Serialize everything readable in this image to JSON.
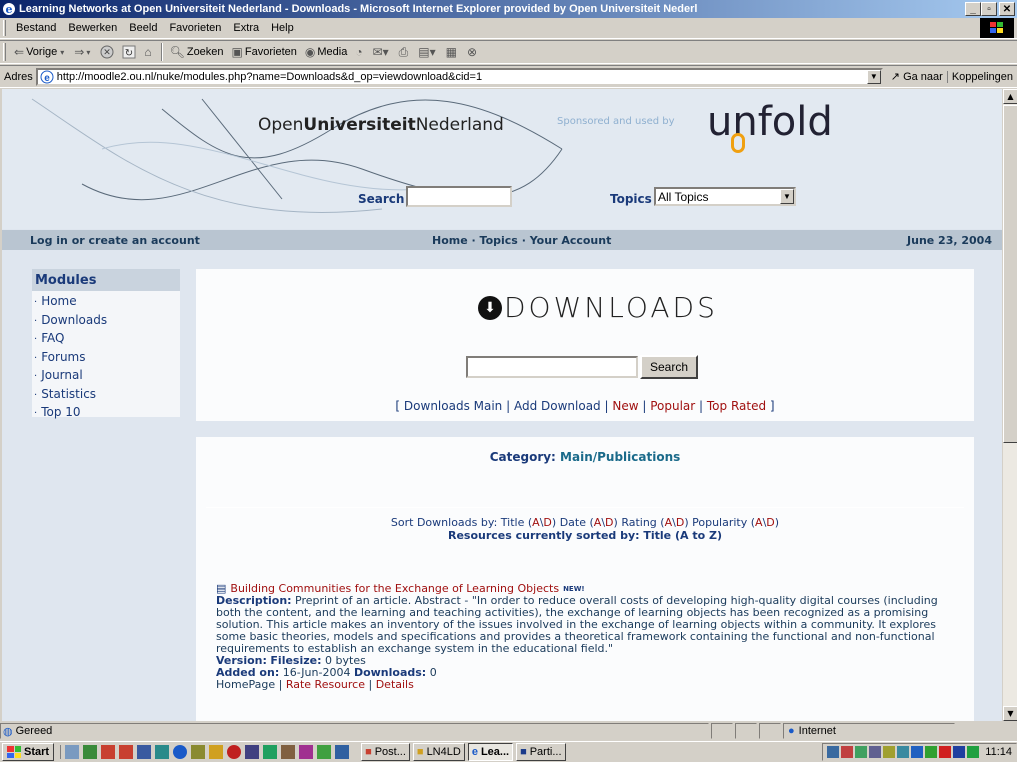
{
  "window": {
    "title": "Learning Networks at Open Universiteit Nederland - Downloads - Microsoft Internet Explorer provided by Open Universiteit Nederl"
  },
  "menu": [
    "Bestand",
    "Bewerken",
    "Beeld",
    "Favorieten",
    "Extra",
    "Help"
  ],
  "toolbar": {
    "back": "Vorige",
    "search": "Zoeken",
    "favorites": "Favorieten",
    "media": "Media"
  },
  "address": {
    "label": "Adres",
    "url": "http://moodle2.ou.nl/nuke/modules.php?name=Downloads&d_op=viewdownload&cid=1",
    "go": "Ga naar",
    "links": "Koppelingen"
  },
  "header": {
    "logo_pre": "Open",
    "logo_bold": "Universiteit",
    "logo_post": "Nederland",
    "sponsored": "Sponsored and used by",
    "unfold": "unfold",
    "search_label": "Search",
    "topics_label": "Topics",
    "topics_value": "All Topics"
  },
  "navbar": {
    "login": "Log in or create an account",
    "home": "Home",
    "topics": "Topics",
    "account": "Your Account",
    "date": "June 23, 2004"
  },
  "modules": {
    "title": "Modules",
    "items": [
      "Home",
      "Downloads",
      "FAQ",
      "Forums",
      "Journal",
      "Statistics",
      "Top 10"
    ]
  },
  "downloads": {
    "logo_text": "DOWNLOADS",
    "search_button": "Search",
    "links": {
      "main": "Downloads Main",
      "add": "Add Download",
      "new": "New",
      "popular": "Popular",
      "top": "Top Rated"
    }
  },
  "category": {
    "label": "Category:",
    "value": "Main/Publications",
    "sort_label": "Sort Downloads by:",
    "sort_title": "Title",
    "sort_date": "Date",
    "sort_rating": "Rating",
    "sort_popularity": "Popularity",
    "sorted_label": "Resources currently sorted by: Title (A to Z)"
  },
  "item": {
    "title": "Building Communities for the Exchange of Learning Objects",
    "new_badge": "NEW!",
    "desc_label": "Description:",
    "desc": "Preprint of an article. Abstract - \"In order to reduce overall costs of developing high-quality digital courses (including both the content, and the learning and teaching activities), the exchange of learning objects has been recognized as a promising solution. This article makes an inventory of the issues involved in the exchange of learning objects within a community. It explores some basic theories, models and specifications and provides a theoretical framework containing the functional and non-functional requirements to establish an exchange system in the educational field.\"",
    "version_label": "Version:",
    "filesize_label": "Filesize:",
    "filesize": "0 bytes",
    "added_label": "Added on:",
    "added": "16-Jun-2004",
    "downloads_label": "Downloads:",
    "downloads": "0",
    "homepage": "HomePage",
    "rate": "Rate Resource",
    "details": "Details"
  },
  "status": {
    "ready": "Gereed",
    "zone": "Internet"
  },
  "taskbar": {
    "start": "Start",
    "tasks": [
      "Post...",
      "LN4LD",
      "Lea...",
      "Parti..."
    ],
    "clock": "11:14"
  },
  "colors": {
    "titlebar_start": "#0a246a",
    "titlebar_end": "#a6caf0",
    "link_red": "#a01010",
    "nav_blue": "#1a3a7a",
    "page_bg": "#dfe6ef"
  }
}
